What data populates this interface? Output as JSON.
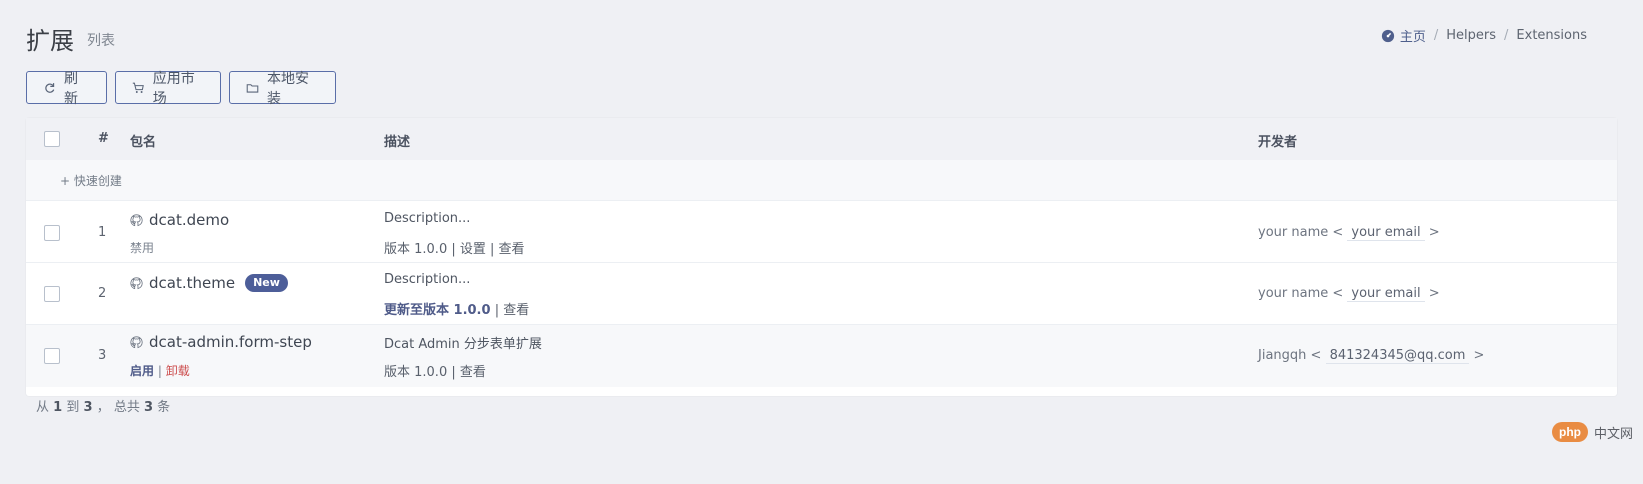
{
  "page": {
    "title": "扩展",
    "subtitle": "列表"
  },
  "breadcrumb": {
    "home": "主页",
    "items": [
      "Helpers",
      "Extensions"
    ]
  },
  "toolbar": {
    "refresh": "刷新",
    "market": "应用市场",
    "local_install": "本地安装"
  },
  "table": {
    "headers": [
      "#",
      "包名",
      "描述",
      "开发者"
    ],
    "quick_create": "快速创建",
    "rows": [
      {
        "index": "1",
        "package": "dcat.demo",
        "status": "禁用",
        "description": "Description...",
        "version_text": "版本 1.0.0",
        "actions": "| 设置 | 查看",
        "developer": "your name",
        "email": "your email"
      },
      {
        "index": "2",
        "package": "dcat.theme",
        "badge": "New",
        "description": "Description...",
        "version_text": "更新至版本 1.0.0",
        "actions": "| 查看",
        "developer": "your name",
        "email": "your email"
      },
      {
        "index": "3",
        "package": "dcat-admin.form-step",
        "status_enable": "启用",
        "status_disable": "卸载",
        "description": "Dcat Admin 分步表单扩展",
        "version_text": "版本 1.0.0",
        "actions": "| 查看",
        "developer": "Jiangqh",
        "email": "841324345@qq.com"
      }
    ]
  },
  "footer": {
    "from": "从",
    "start": "1",
    "to": "到",
    "end": "3",
    "total_prefix": "， 总共",
    "total": "3",
    "unit": "条"
  },
  "watermark": {
    "brand": "php",
    "text": "中文网"
  },
  "icons": [
    "dashboard-icon",
    "refresh-icon",
    "cart-icon",
    "folder-icon",
    "github-icon"
  ]
}
